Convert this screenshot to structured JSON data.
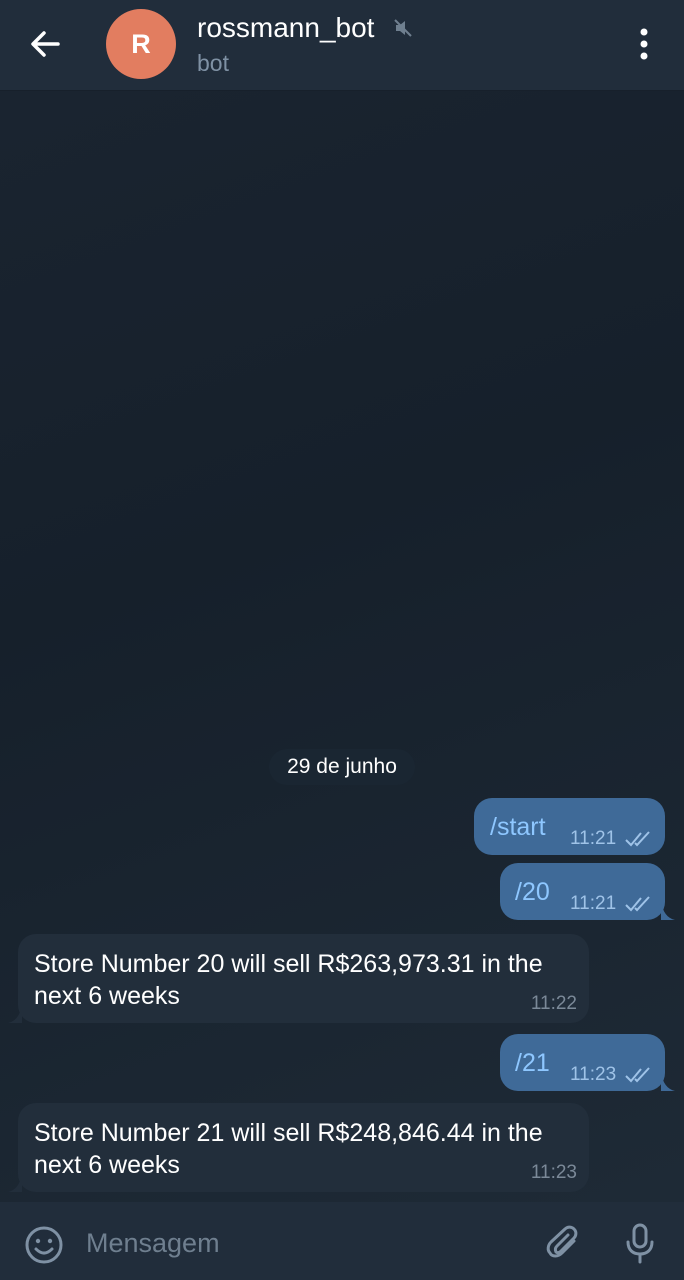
{
  "header": {
    "title": "rossmann_bot",
    "subtitle": "bot",
    "avatar_letter": "R",
    "avatar_color": "#e27d60"
  },
  "chat": {
    "date_label": "29 de junho",
    "messages": [
      {
        "direction": "outgoing",
        "text": "/start",
        "time": "11:21",
        "status": "read"
      },
      {
        "direction": "outgoing",
        "text": "/20",
        "time": "11:21",
        "status": "read"
      },
      {
        "direction": "incoming",
        "text": "Store Number 20 will sell R$263,973.31 in the next 6 weeks",
        "time": "11:22"
      },
      {
        "direction": "outgoing",
        "text": "/21",
        "time": "11:23",
        "status": "read"
      },
      {
        "direction": "incoming",
        "text": "Store Number 21 will sell R$248,846.44 in the next 6 weeks",
        "time": "11:23"
      }
    ]
  },
  "composer": {
    "placeholder": "Mensagem"
  },
  "icons": {
    "back": "arrow-left-icon",
    "mute": "muted-speaker-icon",
    "menu": "more-vertical-icon",
    "read": "double-check-icon",
    "emoji": "smile-icon",
    "attach": "paperclip-icon",
    "mic": "microphone-icon"
  },
  "colors": {
    "header_bg": "#212d3b",
    "outgoing_bubble": "#3f6a98",
    "incoming_bubble": "#222e3b",
    "command_link": "#8ec7ff"
  }
}
